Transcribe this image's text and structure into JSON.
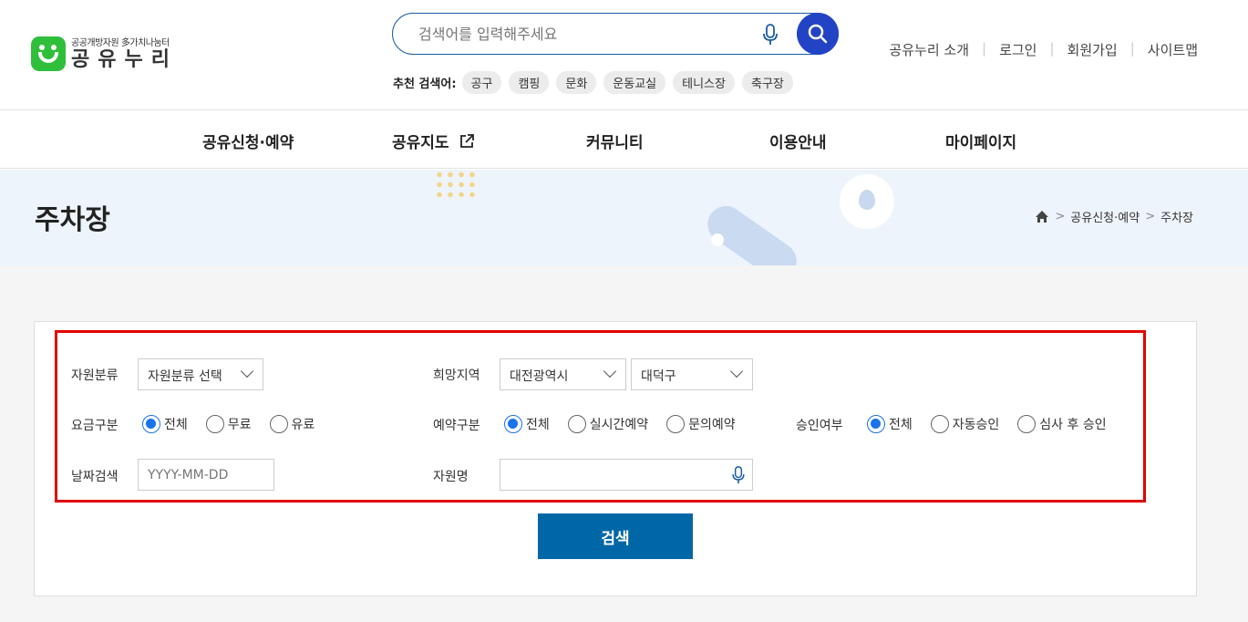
{
  "logo": {
    "sub": "공공개방자원 多가치나눔터",
    "main": "공유누리"
  },
  "search": {
    "placeholder": "검색어를 입력해주세요"
  },
  "recommended": {
    "label": "추천 검색어:",
    "tags": [
      "공구",
      "캠핑",
      "문화",
      "운동교실",
      "테니스장",
      "축구장"
    ]
  },
  "util_links": [
    "공유누리 소개",
    "로그인",
    "회원가입",
    "사이트맵"
  ],
  "nav": [
    "공유신청·예약",
    "공유지도",
    "커뮤니티",
    "이용안내",
    "마이페이지"
  ],
  "page": {
    "title": "주차장",
    "breadcrumb": [
      "공유신청·예약",
      "주차장"
    ]
  },
  "filters": {
    "resource_category": {
      "label": "자원분류",
      "value": "자원분류 선택"
    },
    "region": {
      "label": "희망지역",
      "city": "대전광역시",
      "district": "대덕구"
    },
    "fee": {
      "label": "요금구분",
      "options": [
        "전체",
        "무료",
        "유료"
      ],
      "selected": "전체"
    },
    "reservation": {
      "label": "예약구분",
      "options": [
        "전체",
        "실시간예약",
        "문의예약"
      ],
      "selected": "전체"
    },
    "approval": {
      "label": "승인여부",
      "options": [
        "전체",
        "자동승인",
        "심사 후 승인"
      ],
      "selected": "전체"
    },
    "date": {
      "label": "날짜검색",
      "placeholder": "YYYY-MM-DD"
    },
    "name": {
      "label": "자원명",
      "value": ""
    }
  },
  "submit_label": "검색",
  "colors": {
    "accent": "#2343c5",
    "submit": "#0067a7",
    "radio": "#1a73e8",
    "highlight": "#e10000"
  }
}
